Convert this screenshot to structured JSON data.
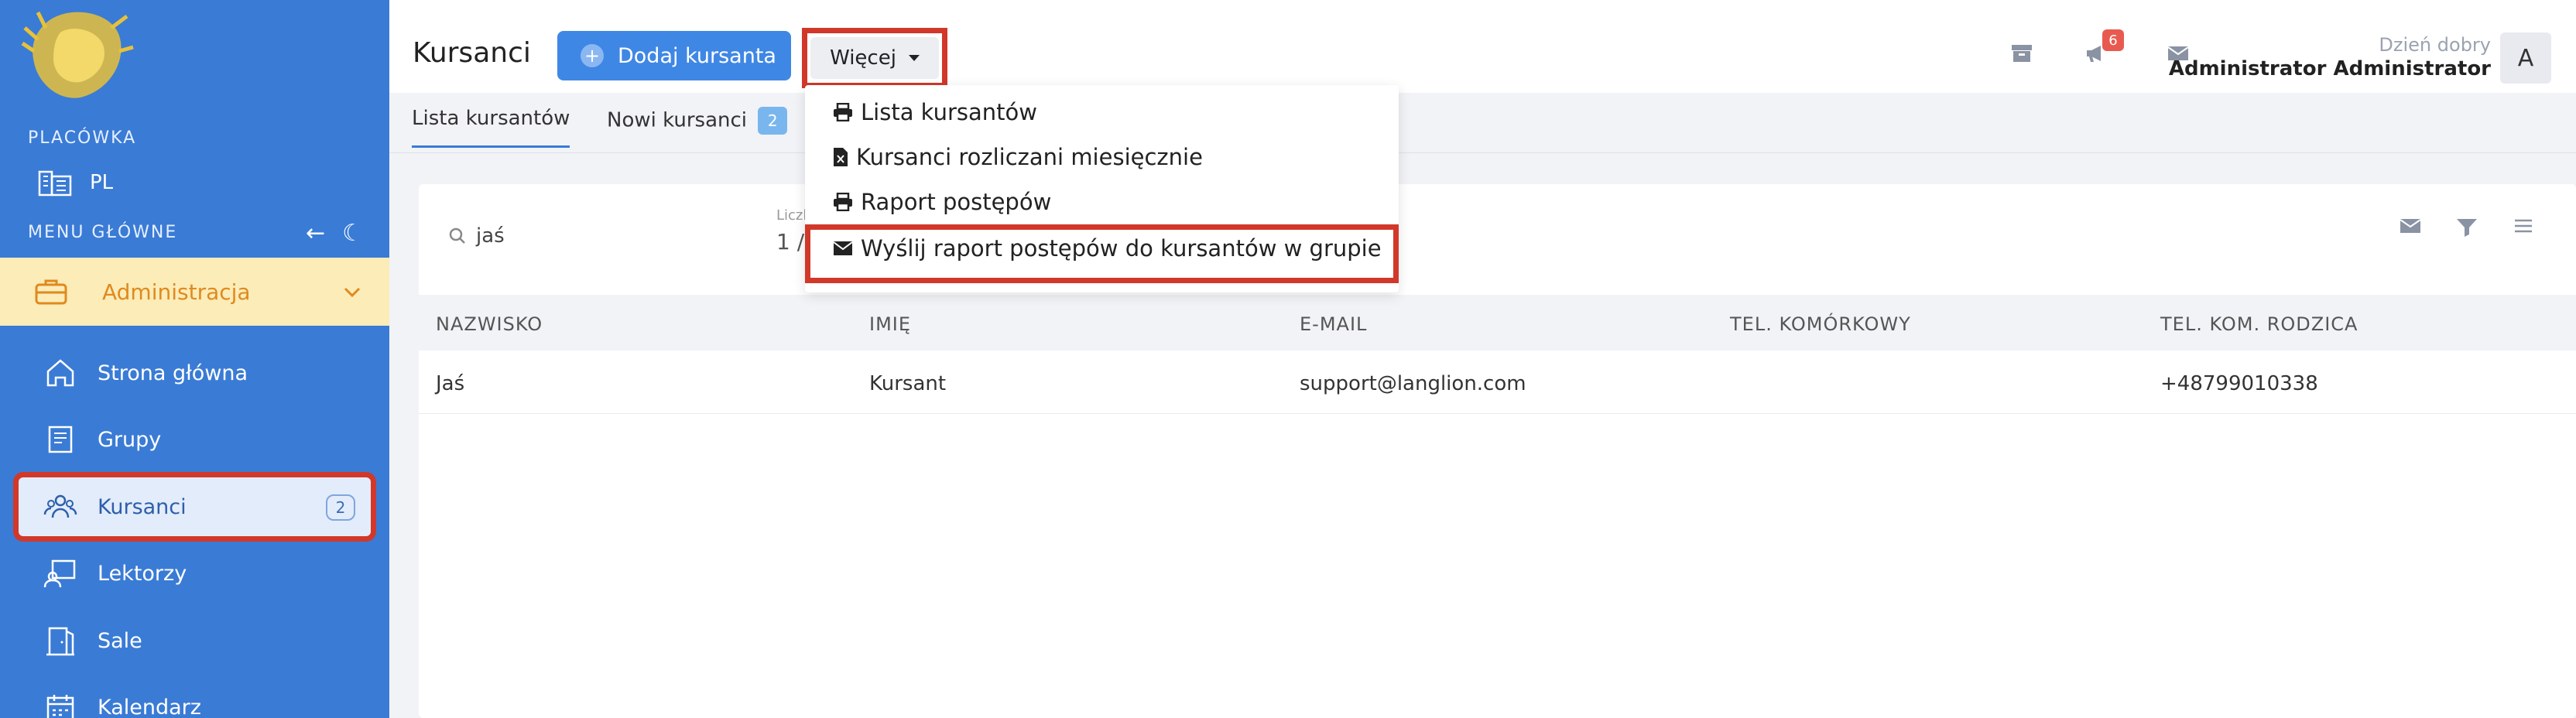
{
  "sidebar": {
    "section_placowka": "PLACÓWKA",
    "placowka_value": "PL",
    "section_menu": "MENU GŁÓWNE",
    "admin_label": "Administracja",
    "items": [
      {
        "label": "Strona główna"
      },
      {
        "label": "Grupy"
      },
      {
        "label": "Kursanci",
        "badge": "2"
      },
      {
        "label": "Lektorzy"
      },
      {
        "label": "Sale"
      },
      {
        "label": "Kalendarz"
      }
    ]
  },
  "header": {
    "title": "Kursanci",
    "add_button": "Dodaj kursanta",
    "more_button": "Więcej",
    "notifications_count": "6",
    "greeting": "Dzień dobry",
    "user_name": "Administrator Administrator",
    "avatar_letter": "A"
  },
  "tabs": [
    {
      "label": "Lista kursantów"
    },
    {
      "label": "Nowi kursanci",
      "badge": "2"
    }
  ],
  "dropdown": {
    "items": [
      {
        "label": "Lista kursantów"
      },
      {
        "label": "Kursanci rozliczani miesięcznie"
      },
      {
        "label": "Raport postępów"
      },
      {
        "label": "Wyślij raport postępów do kursantów w grupie"
      }
    ]
  },
  "filters": {
    "search_value": "jaś",
    "count_label": "Liczb",
    "count_value": "1 /"
  },
  "table": {
    "headers": [
      "NAZWISKO",
      "IMIĘ",
      "E-MAIL",
      "TEL. KOMÓRKOWY",
      "TEL. KOM. RODZICA"
    ],
    "rows": [
      [
        "Jaś",
        "Kursant",
        "support@langlion.com",
        "",
        "+48799010338"
      ]
    ]
  },
  "colors": {
    "sidebar_bg": "#3a7bd5",
    "accent": "#3f87e5",
    "highlight": "#d1382a",
    "admin_bg": "#fbecb8",
    "admin_text": "#e08a1e"
  }
}
